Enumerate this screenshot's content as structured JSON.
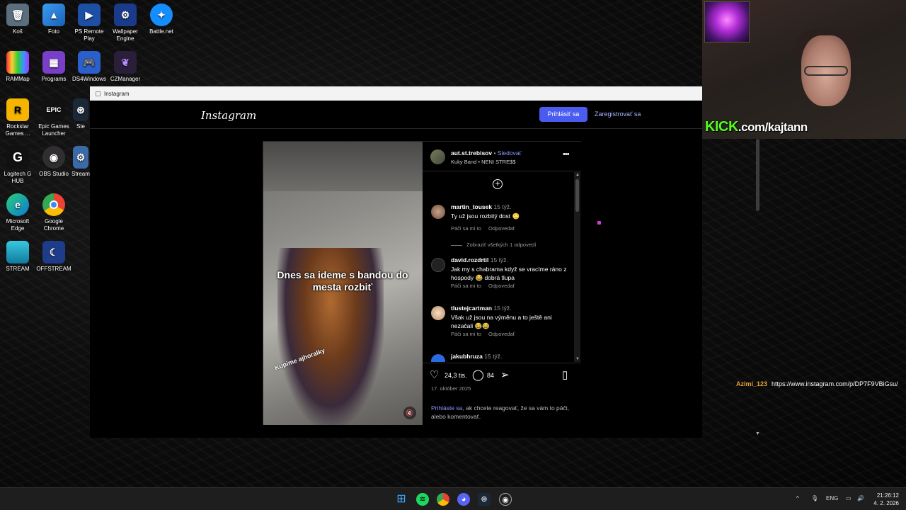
{
  "desktop": {
    "icons": [
      {
        "label": "Koš"
      },
      {
        "label": "Foto"
      },
      {
        "label": "PS Remote Play"
      },
      {
        "label": "Wallpaper Engine"
      },
      {
        "label": "Battle.net"
      },
      {
        "label": "RAMMap"
      },
      {
        "label": "Programs"
      },
      {
        "label": "DS4Windows"
      },
      {
        "label": "CZManager"
      },
      {
        "label": "Rockstar Games ..."
      },
      {
        "label": "Epic Games Launcher"
      },
      {
        "label": "Ste"
      },
      {
        "label": "Logitech G HUB"
      },
      {
        "label": "OBS Studio"
      },
      {
        "label": "Stream"
      },
      {
        "label": "Microsoft Edge"
      },
      {
        "label": "Google Chrome"
      },
      {
        "label": "STREAM"
      },
      {
        "label": "OFFSTREAM"
      }
    ]
  },
  "window": {
    "title": "Instagram"
  },
  "instagram": {
    "logo": "Instagram",
    "login_label": "Prihlásiť sa",
    "register_label": "Zaregistrovať sa"
  },
  "post": {
    "username": "aut.st.trebisov",
    "separator": "•",
    "follow_label": "Sledovať",
    "music": "Kuky Band • NENI STRE$$",
    "caption": "Dnes sa ideme s bandou do mesta rozbiť",
    "tag": "Kupime ajhoralky",
    "likes": "24,3 tis.",
    "comments_count": "84",
    "date": "17. október 2025",
    "login_hint_link": "Prihláste sa,",
    "login_hint_text": " ak chcete reagovať, že sa vám to páči, alebo komentovať."
  },
  "comments": [
    {
      "user": "martin_tousek",
      "time": "15 týž.",
      "text": "Ty už jsou rozbitý dost 😳",
      "like": "Páči sa mi to",
      "reply": "Odpovedať"
    },
    {
      "user": "david.rozdrtil",
      "time": "15 týž.",
      "text": "Jak my s chabrama když se vracíme ráno z hospody 😂 dobrá tlupa",
      "like": "Páči sa mi to",
      "reply": "Odpovedať"
    },
    {
      "user": "tlustejcartman",
      "time": "15 týž.",
      "text": "Však už jsou na výměnu a to ještě ani nezačali 😂😂",
      "like": "Páči sa mi to",
      "reply": "Odpovedať"
    },
    {
      "user": "jakubhruza",
      "time": "15 týž."
    }
  ],
  "replies_label": "Zobraziť všetkých 1 odpovedí",
  "stream": {
    "kick_prefix": "KICK",
    "kick_url": ".com/kajtann",
    "chat_user": "Azimi_123",
    "chat_message": "https://www.instagram.com/p/DP7F9VBiGsu/"
  },
  "taskbar": {
    "lang": "ENG",
    "time": "21:26:12",
    "date": "4. 2. 2026"
  },
  "colors": {
    "accent": "#4a5cf0",
    "kick_green": "#54fc1f",
    "chat_name": "#e8a23a"
  }
}
